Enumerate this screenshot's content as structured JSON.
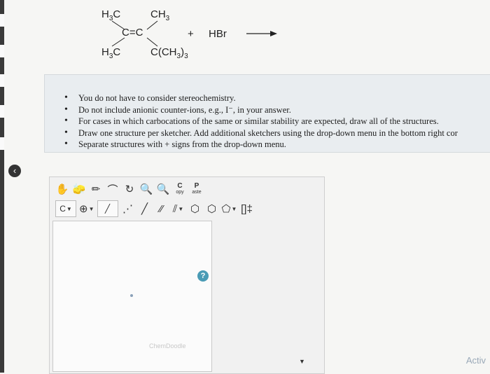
{
  "reaction": {
    "reactant": {
      "top_left": "H3C",
      "top_right": "CH3",
      "bottom_left": "H3C",
      "bottom_right": "C(CH3)3",
      "double_bond": "C=C"
    },
    "plus": "+",
    "reagent": "HBr",
    "arrow": "→"
  },
  "instructions": [
    "You do not have to consider stereochemistry.",
    "Do not include anionic counter-ions, e.g., I⁻, in your answer.",
    "For cases in which carbocations of the same or similar stability are expected, draw all of the structures.",
    "Draw one structure per sketcher. Add additional sketchers using the drop-down menu in the bottom right cor",
    "Separate structures with + signs from the drop-down menu."
  ],
  "collapse_icon": "‹",
  "sketcher": {
    "toolbar_row1": [
      {
        "name": "hand-icon",
        "glyph": "✋"
      },
      {
        "name": "eraser-icon",
        "glyph": "🧽"
      },
      {
        "name": "pencil-icon",
        "glyph": "✏"
      },
      {
        "name": "lasso-icon",
        "glyph": "⌒"
      },
      {
        "name": "rotate-icon",
        "glyph": "↻"
      },
      {
        "name": "zoom-in-icon",
        "glyph": "🔍"
      },
      {
        "name": "zoom-out-icon",
        "glyph": "🔍"
      }
    ],
    "copy_label": "C",
    "copy_sub": "opy",
    "paste_label": "P",
    "paste_sub": "aste",
    "atom_label": "C",
    "charge_label": "⊕",
    "bond_tools": [
      "╱",
      "⋰",
      "╱",
      "⁄⁄",
      "⫽"
    ],
    "ring_tools": [
      "⬡",
      "⬡",
      "⬠"
    ],
    "bracket_label": "[]‡",
    "help_label": "?",
    "watermark": "ChemDoodle",
    "dropdown_caret": "▼"
  },
  "activate_text": "Activ"
}
